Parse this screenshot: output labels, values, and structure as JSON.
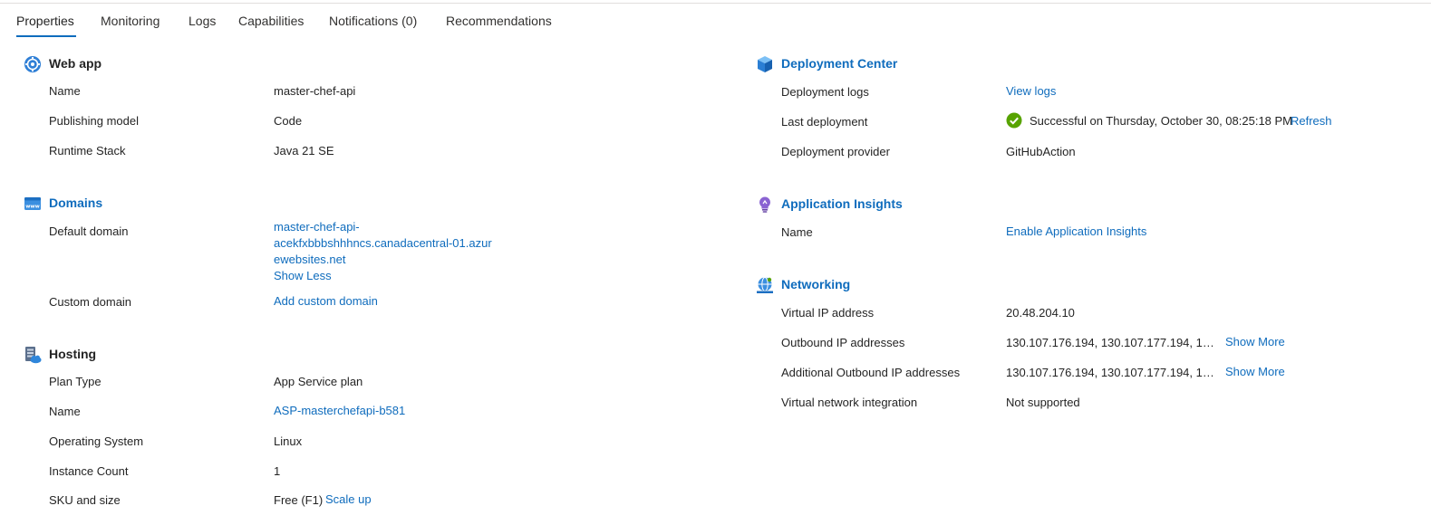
{
  "tabs": [
    {
      "label": "Properties",
      "active": true
    },
    {
      "label": "Monitoring"
    },
    {
      "label": "Logs"
    },
    {
      "label": "Capabilities"
    },
    {
      "label": "Notifications (0)"
    },
    {
      "label": "Recommendations"
    }
  ],
  "web_app": {
    "title": "Web app",
    "icon": "globe-gear-icon",
    "rows": [
      {
        "label": "Name",
        "value": "master-chef-api"
      },
      {
        "label": "Publishing model",
        "value": "Code"
      },
      {
        "label": "Runtime Stack",
        "value": "Java 21 SE"
      }
    ]
  },
  "domains": {
    "title": "Domains",
    "icon": "www-icon",
    "default_domain_label": "Default domain",
    "default_domain_lines": [
      "master-chef-api-",
      "acekfxbbbshhhncs.canadacentral-01.azur",
      "ewebsites.net"
    ],
    "show_less": "Show Less",
    "custom_domain_label": "Custom domain",
    "custom_domain_link": "Add custom domain"
  },
  "hosting": {
    "title": "Hosting",
    "icon": "app-service-plan-icon",
    "plan_type_label": "Plan Type",
    "plan_type_value": "App Service plan",
    "name_label": "Name",
    "name_link": "ASP-masterchefapi-b581",
    "os_label": "Operating System",
    "os_value": "Linux",
    "instance_label": "Instance Count",
    "instance_value": "1",
    "sku_label": "SKU and size",
    "sku_value": "Free (F1)",
    "scale_up": "Scale up"
  },
  "deployment_center": {
    "title": "Deployment Center",
    "icon": "deployment-cube-icon",
    "logs_label": "Deployment logs",
    "logs_link": "View logs",
    "last_label": "Last deployment",
    "last_value": "Successful on Thursday, October 30, 08:25:18 PM",
    "refresh": "Refresh",
    "provider_label": "Deployment provider",
    "provider_value": "GitHubAction",
    "success_color": "#57a300"
  },
  "app_insights": {
    "title": "Application Insights",
    "icon": "lightbulb-icon",
    "name_label": "Name",
    "enable_link": "Enable Application Insights"
  },
  "networking": {
    "title": "Networking",
    "icon": "network-globe-icon",
    "vip_label": "Virtual IP address",
    "vip_value": "20.48.204.10",
    "outbound_label": "Outbound IP addresses",
    "outbound_value": "130.107.176.194, 130.107.177.194, 130....",
    "additional_label": "Additional Outbound IP addresses",
    "additional_value": "130.107.176.194, 130.107.177.194, 130....",
    "show_more": "Show More",
    "vnet_label": "Virtual network integration",
    "vnet_value": "Not supported"
  },
  "colors": {
    "accent": "#0f6cbd",
    "text": "#242424"
  }
}
